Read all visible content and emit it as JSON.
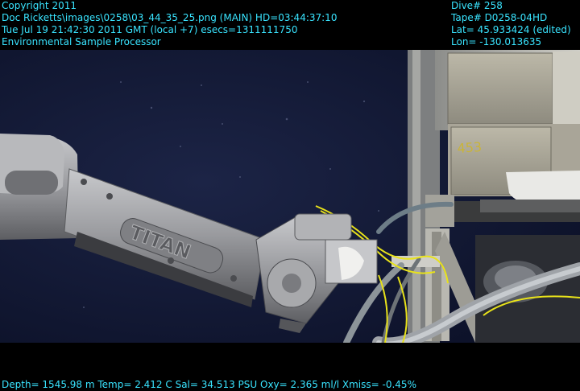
{
  "overlay": {
    "top_left": [
      "Copyright 2011",
      "Doc Ricketts\\images\\0258\\03_44_35_25.png (MAIN)  HD=03:44:37:10",
      "Tue Jul 19 21:42:30 2011 GMT (local +7)  esecs=1311111750",
      "Environmental Sample Processor"
    ],
    "top_right": [
      "Dive# 258",
      "Tape# D0258-04HD",
      "Lat= 45.933424 (edited)",
      "Lon= -130.013635"
    ],
    "bottom": "Depth= 1545.98 m  Temp= 2.412 C  Sal= 34.513 PSU  Oxy= 2.365 ml/l  Xmiss= -0.45%"
  },
  "scene": {
    "arm_logo": "TITAN",
    "box_marking": "453"
  },
  "colors": {
    "overlay_text": "#39e4ff",
    "water": "#131a35",
    "arm_metal": "#9a9b9f",
    "yellow_line": "#e8e21a"
  }
}
